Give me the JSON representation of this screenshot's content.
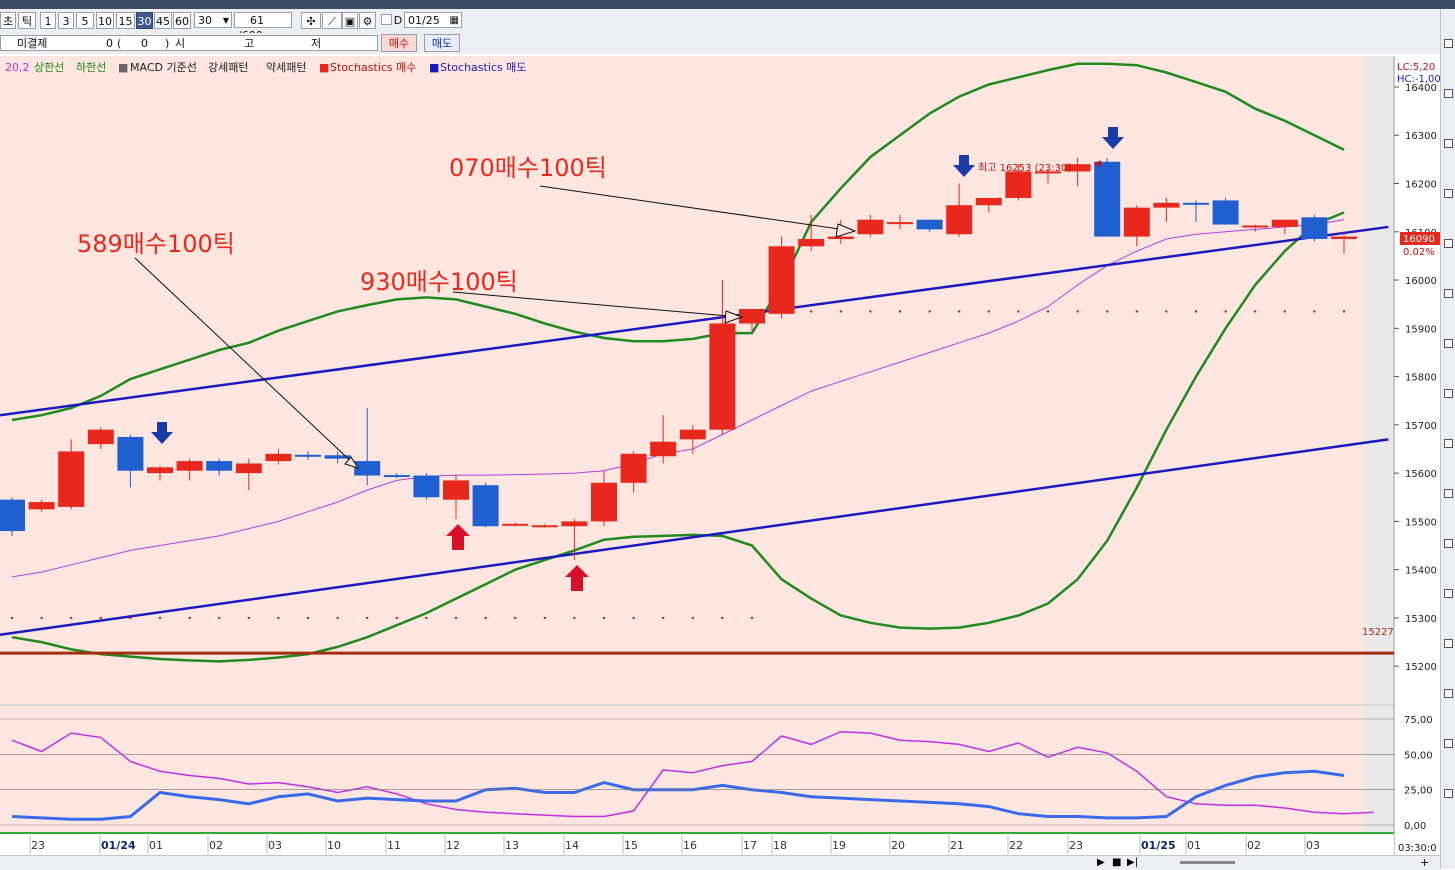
{
  "toolbar": {
    "buttons": [
      "초",
      "틱",
      "1",
      "3",
      "5",
      "10",
      "15",
      "30",
      "45",
      "60"
    ],
    "active_button": "30",
    "interval_value": "30",
    "count_value": "61",
    "count_total": "/600",
    "date_value": "01/25",
    "checkbox_label": "D"
  },
  "toolbar2": {
    "unsettled_label": "미결제",
    "unsettled_value": "0",
    "paren_open": "(",
    "paren_value": "0",
    "paren_close": ")",
    "open_label": "시",
    "high_label": "고",
    "low_label": "저",
    "buy_label": "매수",
    "sell_label": "매도"
  },
  "legend": {
    "bb_param": "20,2",
    "upper": "상한선",
    "lower": "하한선",
    "macd": "MACD 기준선",
    "strong": "강세패턴",
    "weak": "약세패턴",
    "stoch_buy": "Stochastics 매수",
    "stoch_sell": "Stochastics 매도"
  },
  "top_right": {
    "lc": "LC:5,20",
    "hc": "HC:-1,00"
  },
  "annotations": {
    "a1": "589매수100틱",
    "a2": "930매수100틱",
    "a3": "070매수100틱",
    "high_label": "최고 16253 (23:30)",
    "support_value": "15227",
    "current_price": "16090",
    "current_change": "0.02%"
  },
  "colors": {
    "background": "#fde6df",
    "up": "#e8281c",
    "down": "#1f5fd0",
    "bollinger": "#1f8a1f",
    "ma": "#b040e0",
    "trend": "#1a1ac0",
    "support": "#a03010",
    "stoch_k": "#c030e0",
    "stoch_d": "#3a6ae8"
  },
  "chart_data": {
    "type": "candlestick",
    "ylim": [
      15130,
      16460
    ],
    "yticks": [
      15200,
      15300,
      15400,
      15500,
      15600,
      15700,
      15800,
      15900,
      16000,
      16100,
      16200,
      16300,
      16400
    ],
    "xticks": [
      "23",
      "01/24",
      "01",
      "02",
      "03",
      "10",
      "11",
      "12",
      "13",
      "14",
      "15",
      "16",
      "17",
      "18",
      "19",
      "20",
      "21",
      "22",
      "23",
      "01/25",
      "01",
      "02",
      "03"
    ],
    "time_readout": "03:30:0",
    "candles": [
      [
        15545,
        15550,
        15470,
        15480
      ],
      [
        15525,
        15545,
        15520,
        15540
      ],
      [
        15530,
        15670,
        15525,
        15645
      ],
      [
        15660,
        15695,
        15650,
        15690
      ],
      [
        15675,
        15680,
        15570,
        15605
      ],
      [
        15600,
        15615,
        15585,
        15612
      ],
      [
        15605,
        15630,
        15585,
        15625
      ],
      [
        15625,
        15630,
        15595,
        15605
      ],
      [
        15600,
        15630,
        15565,
        15620
      ],
      [
        15625,
        15650,
        15618,
        15640
      ],
      [
        15638,
        15645,
        15628,
        15635
      ],
      [
        15637,
        15645,
        15620,
        15630
      ],
      [
        15625,
        15735,
        15575,
        15595
      ],
      [
        15596,
        15600,
        15590,
        15595
      ],
      [
        15595,
        15600,
        15545,
        15550
      ],
      [
        15545,
        15595,
        15505,
        15585
      ],
      [
        15575,
        15580,
        15488,
        15490
      ],
      [
        15495,
        15498,
        15490,
        15495
      ],
      [
        15490,
        15495,
        15487,
        15492
      ],
      [
        15490,
        15505,
        15420,
        15500
      ],
      [
        15500,
        15605,
        15490,
        15580
      ],
      [
        15580,
        15645,
        15560,
        15640
      ],
      [
        15635,
        15720,
        15620,
        15665
      ],
      [
        15670,
        15700,
        15640,
        15690
      ],
      [
        15690,
        16000,
        15680,
        15910
      ],
      [
        15910,
        15940,
        15890,
        15940
      ],
      [
        15930,
        16090,
        15920,
        16070
      ],
      [
        16070,
        16135,
        16060,
        16085
      ],
      [
        16085,
        16125,
        16075,
        16090
      ],
      [
        16095,
        16135,
        16090,
        16125
      ],
      [
        16120,
        16135,
        16105,
        16120
      ],
      [
        16125,
        16125,
        16100,
        16105
      ],
      [
        16095,
        16200,
        16090,
        16155
      ],
      [
        16155,
        16170,
        16140,
        16170
      ],
      [
        16170,
        16240,
        16165,
        16225
      ],
      [
        16225,
        16230,
        16200,
        16225
      ],
      [
        16225,
        16253,
        16195,
        16240
      ],
      [
        16245,
        16253,
        16090,
        16090
      ],
      [
        16090,
        16155,
        16070,
        16150
      ],
      [
        16150,
        16170,
        16120,
        16160
      ],
      [
        16160,
        16165,
        16120,
        16158
      ],
      [
        16165,
        16170,
        16115,
        16115
      ],
      [
        16110,
        16115,
        16100,
        16113
      ],
      [
        16110,
        16125,
        16095,
        16125
      ],
      [
        16130,
        16135,
        16080,
        16085
      ],
      [
        16085,
        16100,
        16055,
        16090
      ]
    ],
    "bb_upper": [
      15710,
      15720,
      15735,
      15760,
      15795,
      15815,
      15835,
      15855,
      15870,
      15895,
      15915,
      15935,
      15948,
      15960,
      15964,
      15960,
      15945,
      15930,
      15910,
      15893,
      15880,
      15873,
      15873,
      15878,
      15890,
      15890,
      15990,
      16120,
      16190,
      16255,
      16300,
      16345,
      16380,
      16405,
      16420,
      16435,
      16448,
      16448,
      16445,
      16430,
      16410,
      16390,
      16355,
      16330,
      16300,
      16270
    ],
    "bb_lower": [
      15260,
      15250,
      15235,
      15225,
      15220,
      15215,
      15212,
      15210,
      15213,
      15218,
      15225,
      15240,
      15260,
      15285,
      15310,
      15340,
      15370,
      15400,
      15420,
      15440,
      15462,
      15468,
      15470,
      15472,
      15470,
      15450,
      15380,
      15340,
      15305,
      15290,
      15280,
      15278,
      15280,
      15290,
      15305,
      15330,
      15380,
      15460,
      15570,
      15690,
      15800,
      15900,
      15990,
      16060,
      16115,
      16140
    ],
    "ma": [
      15385,
      15395,
      15410,
      15425,
      15440,
      15450,
      15460,
      15470,
      15485,
      15500,
      15520,
      15540,
      15565,
      15585,
      15593,
      15596,
      15596,
      15597,
      15598,
      15600,
      15605,
      15620,
      15640,
      15650,
      15680,
      15710,
      15740,
      15770,
      15790,
      15810,
      15830,
      15850,
      15870,
      15890,
      15915,
      15945,
      15990,
      16030,
      16060,
      16085,
      16095,
      16100,
      16105,
      16110,
      16115,
      16125
    ],
    "trend_upper": {
      "from": [
        -1,
        15715
      ],
      "to": [
        46.5,
        16110
      ]
    },
    "trend_lower": {
      "from": [
        -1,
        15260
      ],
      "to": [
        46.5,
        15670
      ]
    },
    "support_line": 15227,
    "stoch_ylim": [
      0,
      75
    ],
    "stoch_yticks": [
      "75,00",
      "50,00",
      "25,00",
      "0,00"
    ],
    "stoch_k": [
      60,
      52,
      65,
      62,
      45,
      38,
      35,
      33,
      29,
      30,
      27,
      23,
      27,
      22,
      15,
      11,
      9,
      8,
      7,
      6,
      6,
      10,
      39,
      37,
      42,
      45,
      63,
      57,
      66,
      65,
      60,
      59,
      57,
      52,
      58,
      48,
      55,
      51,
      38,
      20,
      15,
      14,
      14,
      12,
      9,
      8,
      9
    ],
    "stoch_d": [
      6,
      5,
      4,
      4,
      6,
      23,
      20,
      18,
      15,
      20,
      22,
      17,
      19,
      18,
      17,
      17,
      25,
      26,
      23,
      23,
      30,
      25,
      25,
      25,
      28,
      25,
      23,
      20,
      19,
      18,
      17,
      16,
      15,
      13,
      8,
      6,
      6,
      5,
      5,
      6,
      20,
      28,
      34,
      37,
      38,
      35
    ]
  }
}
